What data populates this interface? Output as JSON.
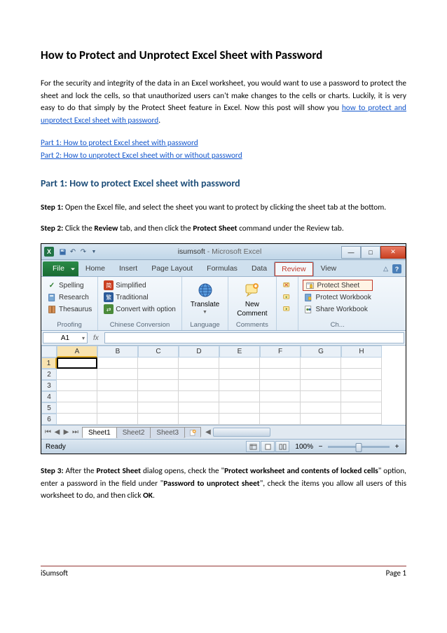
{
  "doc": {
    "title": "How to Protect and Unprotect Excel Sheet with Password",
    "intro_before_link": "For the security and integrity of the data in an Excel worksheet, you would want to use a password to protect the sheet and lock the cells, so that unauthorized users can't make changes to the cells or charts. Luckily, it is very easy to do that simply by the Protect Sheet feature in Excel. Now this post will show you ",
    "intro_link": "how to protect and unprotect Excel sheet with password",
    "intro_after_link": ".",
    "toc_part1": "Part 1: How to protect Excel sheet with password",
    "toc_part2": "Part 2: How to unprotect Excel sheet with or without password",
    "part1_heading": "Part 1: How to protect Excel sheet with password",
    "step1_label": "Step 1:",
    "step1_text": " Open the Excel file, and select the sheet you want to protect by clicking the sheet tab at the bottom.",
    "step2_label": "Step 2:",
    "step2_text_a": " Click the ",
    "step2_bold_a": "Review",
    "step2_text_b": " tab, and then click the ",
    "step2_bold_b": "Protect Sheet",
    "step2_text_c": " command under the Review tab.",
    "step3_label": "Step 3:",
    "step3_text_a": " After the ",
    "step3_bold_a": "Protect Sheet",
    "step3_text_b": " dialog opens, check the \"",
    "step3_bold_b": "Protect worksheet and contents of locked cells",
    "step3_text_c": "\" option, enter a password in the field under \"",
    "step3_bold_c": "Password to unprotect sheet",
    "step3_text_d": "\", check the items you allow all users of this worksheet to do, and then click ",
    "step3_bold_d": "OK",
    "step3_text_e": "."
  },
  "excel": {
    "wintitle_doc": "isumsoft",
    "wintitle_app": " - Microsoft Excel",
    "tabs": {
      "file": "File",
      "home": "Home",
      "insert": "Insert",
      "pagelayout": "Page Layout",
      "formulas": "Formulas",
      "data": "Data",
      "review": "Review",
      "view": "View"
    },
    "proofing": {
      "spelling": "Spelling",
      "research": "Research",
      "thesaurus": "Thesaurus",
      "label": "Proofing"
    },
    "chinese": {
      "simplified": "Simplified",
      "traditional": "Traditional",
      "convert": "Convert with option",
      "label": "Chinese Conversion"
    },
    "language": {
      "translate": "Translate",
      "label": "Language"
    },
    "comments": {
      "new": "New",
      "comment": "Comment",
      "label": "Comments"
    },
    "changes": {
      "protect_sheet": "Protect Sheet",
      "protect_workbook": "Protect Workbook",
      "share_workbook": "Share Workbook",
      "label": "Ch..."
    },
    "namebox": "A1",
    "fx": "fx",
    "cols": [
      "A",
      "B",
      "C",
      "D",
      "E",
      "F",
      "G",
      "H"
    ],
    "rows": [
      "1",
      "2",
      "3",
      "4",
      "5",
      "6"
    ],
    "sheets": {
      "s1": "Sheet1",
      "s2": "Sheet2",
      "s3": "Sheet3"
    },
    "status": "Ready",
    "zoom": "100%"
  },
  "footer": {
    "left": "iSumsoft",
    "right": "Page 1"
  }
}
